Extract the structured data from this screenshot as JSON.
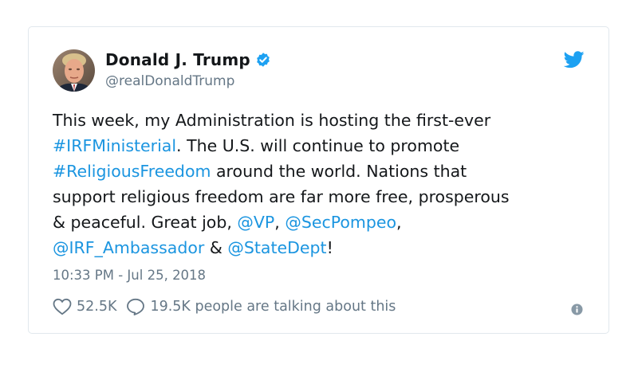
{
  "author": {
    "name": "Donald J. Trump",
    "handle": "@realDonaldTrump",
    "verified_icon": "verified-badge-icon",
    "avatar_icon": "profile-photo"
  },
  "brand": {
    "icon": "twitter-bird-icon",
    "color": "#1da1f2"
  },
  "tweet": {
    "segments": [
      {
        "text": "This week, my Administration is hosting the first-ever",
        "type": "text"
      },
      {
        "text": "\n",
        "type": "break"
      },
      {
        "text": "#IRFMinisterial",
        "type": "link"
      },
      {
        "text": ". The U.S. will continue to promote",
        "type": "text"
      },
      {
        "text": "\n",
        "type": "break"
      },
      {
        "text": "#ReligiousFreedom",
        "type": "link"
      },
      {
        "text": " around the world. Nations that",
        "type": "text"
      },
      {
        "text": "\n",
        "type": "break"
      },
      {
        "text": "support religious freedom are far more free, prosperous",
        "type": "text"
      },
      {
        "text": "\n",
        "type": "break"
      },
      {
        "text": "& peaceful. Great job, ",
        "type": "text"
      },
      {
        "text": "@VP",
        "type": "link"
      },
      {
        "text": ", ",
        "type": "text"
      },
      {
        "text": "@SecPompeo",
        "type": "link"
      },
      {
        "text": ",",
        "type": "text"
      },
      {
        "text": "\n",
        "type": "break"
      },
      {
        "text": "@IRF_Ambassador",
        "type": "link"
      },
      {
        "text": " & ",
        "type": "text"
      },
      {
        "text": "@StateDept",
        "type": "link"
      },
      {
        "text": "!",
        "type": "text"
      }
    ],
    "timestamp": "10:33 PM - Jul 25, 2018"
  },
  "actions": {
    "likes": "52.5K",
    "talking": "19.5K people are talking about this",
    "like_icon": "heart-icon",
    "reply_icon": "speech-bubble-icon",
    "info_icon": "info-icon"
  },
  "colors": {
    "text": "#14171a",
    "secondary": "#657786",
    "link": "#1b95e0",
    "verified": "#1da1f2",
    "border": "#e1e8ed"
  }
}
